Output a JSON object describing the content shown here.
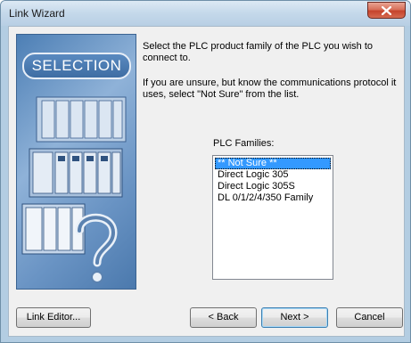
{
  "window": {
    "title": "Link Wizard",
    "close_label": "x"
  },
  "banner": {
    "badge_text": "SELECTION"
  },
  "content": {
    "description_1": "Select the PLC product family of the PLC you wish to connect to.",
    "description_2": "If you are unsure, but know the communications protocol it uses, select \"Not Sure\" from the list.",
    "list_label": "PLC Families:",
    "plc_families": [
      "** Not Sure **",
      "Direct Logic 305",
      "Direct Logic 305S",
      "DL 0/1/2/4/350 Family"
    ],
    "selected_index": 0
  },
  "buttons": {
    "link_editor": "Link Editor...",
    "back": "< Back",
    "next": "Next >",
    "cancel": "Cancel"
  },
  "colors": {
    "selection": "#3399ff",
    "close_button": "#c5432c",
    "banner": "#6a94c4"
  }
}
